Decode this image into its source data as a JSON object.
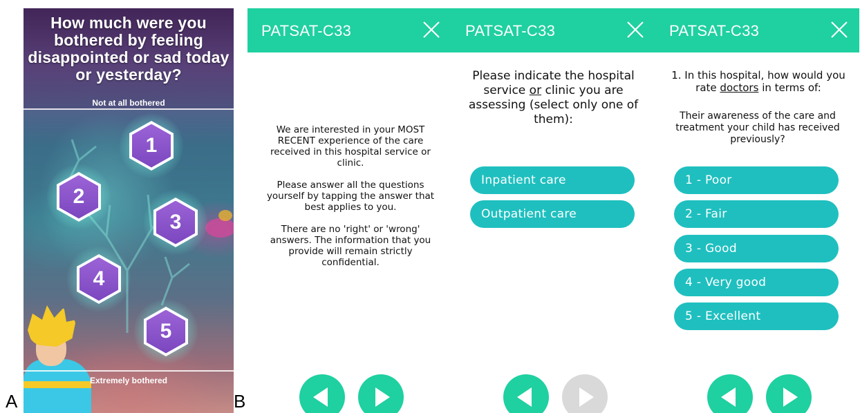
{
  "labels": {
    "panel_a": "A",
    "panel_b": "B"
  },
  "game": {
    "question": "How much were you bothered by feeling disappointed or sad today or yesterday?",
    "scale_top": "Not at all bothered",
    "scale_bottom": "Extremely bothered",
    "options": [
      "1",
      "2",
      "3",
      "4",
      "5"
    ]
  },
  "app": {
    "title": "PATSAT-C33",
    "screens": [
      {
        "intro": [
          "We are interested in your MOST RECENT experience of the care received in this hospital service or clinic.",
          "Please answer all the questions yourself by tapping the answer that best applies to you.",
          "There are no 'right' or 'wrong' answers. The information that you provide will remain strictly confidential."
        ],
        "prev_enabled": true,
        "next_enabled": true
      },
      {
        "prompt_before": "Please indicate the hospital service ",
        "prompt_underlined": "or",
        "prompt_after": " clinic you are assessing (select only one of them):",
        "options": [
          "Inpatient care",
          "Outpatient care"
        ],
        "prev_enabled": true,
        "next_enabled": false
      },
      {
        "question_before": "1. In this hospital, how would you rate ",
        "question_underlined": "doctors",
        "question_after": " in terms of:",
        "subquestion": "Their awareness of the care and treatment your child has received previously?",
        "options": [
          "1 - Poor",
          "2 - Fair",
          "3 - Good",
          "4 - Very good",
          "5 - Excellent"
        ],
        "prev_enabled": true,
        "next_enabled": true
      }
    ]
  },
  "colors": {
    "appbar": "#1fd0a0",
    "option_pill": "#1fbfbf",
    "nav_disabled": "#d9d9d9",
    "hexagon": "#8a55cc"
  },
  "icons": {
    "close": "close-icon",
    "prev": "arrow-left-icon",
    "next": "arrow-right-icon"
  }
}
